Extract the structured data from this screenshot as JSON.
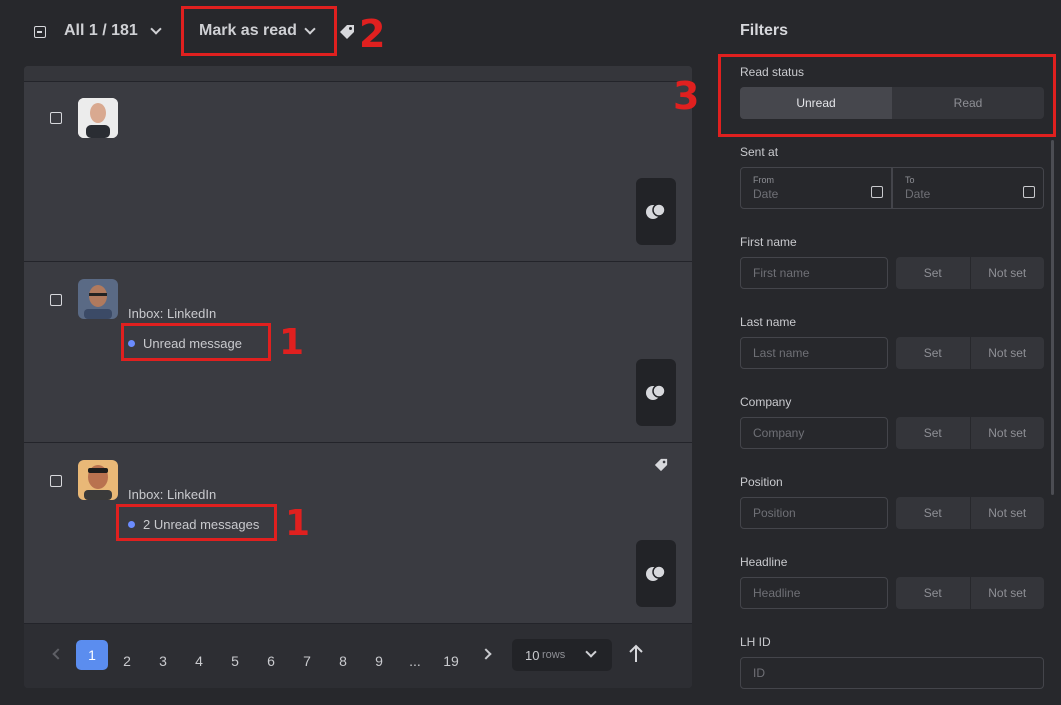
{
  "toolbar": {
    "selection_label": "All 1 / 181",
    "mark_read_label": "Mark as read"
  },
  "annotations": {
    "n1": "1",
    "n2": "2",
    "n3": "3"
  },
  "rows": [
    {
      "inbox": "",
      "status": ""
    },
    {
      "inbox": "Inbox: LinkedIn",
      "status": "Unread message"
    },
    {
      "inbox": "Inbox: LinkedIn",
      "status": "2 Unread messages"
    }
  ],
  "pagination": {
    "pages": [
      "1",
      "2",
      "3",
      "4",
      "5",
      "6",
      "7",
      "8",
      "9",
      "...",
      "19"
    ],
    "current": "1",
    "rows_value": "10",
    "rows_unit": "rows"
  },
  "filters": {
    "title": "Filters",
    "read_status": {
      "label": "Read status",
      "options": [
        "Unread",
        "Read"
      ],
      "selected": "Unread"
    },
    "sent_at": {
      "label": "Sent at",
      "from_label": "From",
      "to_label": "To",
      "placeholder": "Date"
    },
    "fields": [
      {
        "label": "First name",
        "placeholder": "First name",
        "set": "Set",
        "not_set": "Not set"
      },
      {
        "label": "Last name",
        "placeholder": "Last name",
        "set": "Set",
        "not_set": "Not set"
      },
      {
        "label": "Company",
        "placeholder": "Company",
        "set": "Set",
        "not_set": "Not set"
      },
      {
        "label": "Position",
        "placeholder": "Position",
        "set": "Set",
        "not_set": "Not set"
      },
      {
        "label": "Headline",
        "placeholder": "Headline",
        "set": "Set",
        "not_set": "Not set"
      }
    ],
    "lh_id": {
      "label": "LH ID",
      "placeholder": "ID"
    }
  },
  "colors": {
    "background": "#27282c",
    "panel": "#3a3b41",
    "accent": "#5b8def",
    "unread_dot": "#6b8cff",
    "annotation": "#e0201f"
  }
}
